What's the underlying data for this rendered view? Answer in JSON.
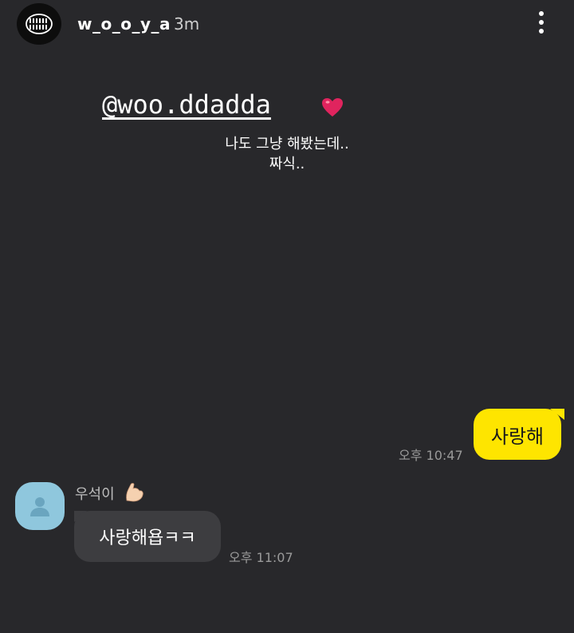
{
  "story": {
    "username": "w_o_o_y_a",
    "time_ago": "3m",
    "mention": "@woo.ddadda",
    "caption": "나도 그냥 해봤는데..\n짜식.."
  },
  "chat": {
    "sent_message": {
      "text": "사랑해",
      "time": "오후 10:47"
    },
    "received_message": {
      "sender": "우석이",
      "text": "사랑해욥ㅋㅋ",
      "time": "오후 11:07"
    }
  },
  "colors": {
    "background": "#28282b",
    "sent_bubble": "#fee500",
    "received_bubble": "#3d3d40",
    "friend_avatar": "#8fc7dd",
    "heart": "#e0245e"
  },
  "icons": [
    "brand-logo-icon",
    "more-options-icon",
    "heart-icon",
    "default-profile-icon",
    "flexed-biceps-icon"
  ]
}
